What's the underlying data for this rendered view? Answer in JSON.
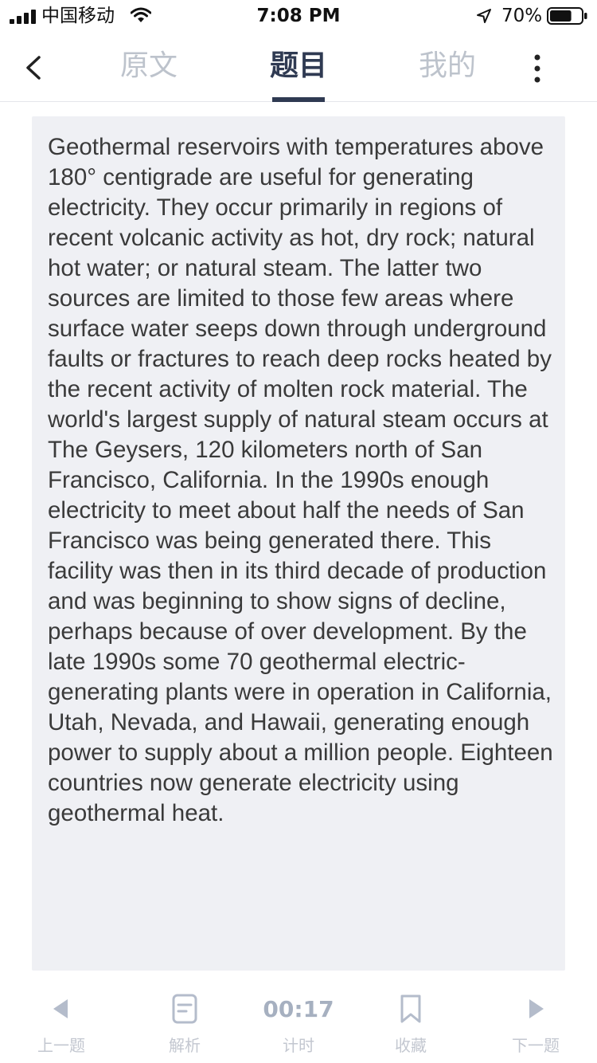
{
  "status_bar": {
    "carrier": "中国移动",
    "time": "7:08 PM",
    "battery_percent": "70%",
    "battery_level": 0.7,
    "icons": [
      "signal-icon",
      "wifi-icon",
      "location-arrow-icon",
      "battery-icon"
    ]
  },
  "nav": {
    "tabs": [
      {
        "label": "原文",
        "active": false
      },
      {
        "label": "题目",
        "active": true
      },
      {
        "label": "我的",
        "active": false
      }
    ],
    "icons": [
      "back-icon",
      "more-vertical-icon"
    ]
  },
  "passage": {
    "text": "Geothermal reservoirs with temperatures above 180° centigrade are useful for generating electricity. They occur primarily in regions of recent volcanic activity as hot, dry rock; natural hot water; or natural steam. The latter two sources are limited to those few areas where surface water seeps down through underground faults or fractures to reach deep rocks heated by the recent activity of molten rock material. The world's largest supply of natural steam occurs at The Geysers, 120 kilometers north of San Francisco, California. In the 1990s enough electricity to meet about half the needs of San Francisco was being generated there. This facility was then in its third decade of production and was beginning to show signs of decline, perhaps because of over development. By the late 1990s some 70 geothermal electric-generating plants were in operation in California, Utah, Nevada, and Hawaii, generating enough power to supply about a million people. Eighteen countries now generate electricity using geothermal heat."
  },
  "toolbar": {
    "prev_label": "上一题",
    "analysis_label": "解析",
    "timer_value": "00:17",
    "timer_label": "计时",
    "favorite_label": "收藏",
    "next_label": "下一题"
  },
  "colors": {
    "nav_active": "#2f3a52",
    "nav_inactive": "#bdc3cc",
    "card_background": "#eff0f4",
    "toolbar_icon": "#b4bccb"
  }
}
